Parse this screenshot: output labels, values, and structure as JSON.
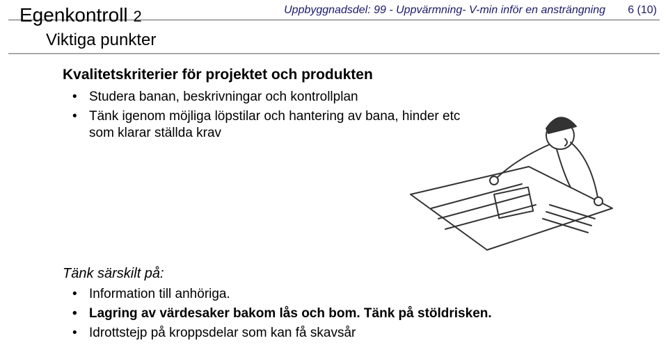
{
  "header": {
    "title_main": "Egenkontroll",
    "title_num": "2",
    "subtitle": "Viktiga punkter",
    "right_text": "Uppbyggnadsdel: 99 - Uppvärmning- V-min inför en ansträngning",
    "page_num": "6 (10)"
  },
  "section1": {
    "heading": "Kvalitetskriterier för projektet och produkten",
    "items": [
      "Studera banan, beskrivningar och kontrollplan",
      "Tänk igenom möjliga löpstilar och hantering av bana, hinder etc som klarar ställda krav"
    ]
  },
  "section2": {
    "heading": "Tänk särskilt på:",
    "items": [
      {
        "text": "Information till anhöriga.",
        "bold": false
      },
      {
        "text": "Lagring av värdesaker bakom lås och bom. Tänk på stöldrisken.",
        "bold": true
      },
      {
        "text": "Idrottstejp på kroppsdelar som kan få skavsår",
        "bold": false
      }
    ]
  }
}
